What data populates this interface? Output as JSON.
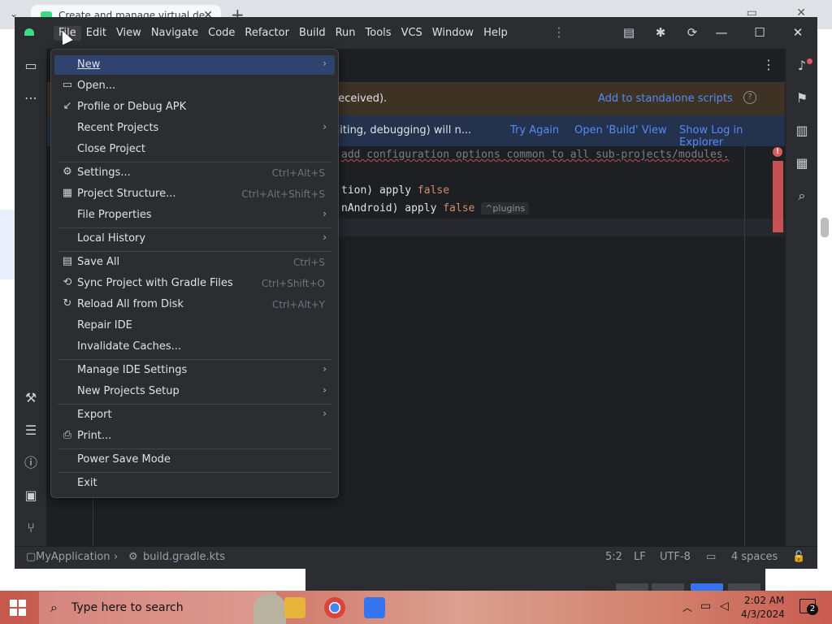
{
  "browser": {
    "tab_title": "Create and manage virtual de",
    "tab_close": "✕",
    "new_tab": "+"
  },
  "ide": {
    "menubar": [
      "File",
      "Edit",
      "View",
      "Navigate",
      "Code",
      "Refactor",
      "Build",
      "Run",
      "Tools",
      "VCS",
      "Window",
      "Help"
    ],
    "banners": {
      "gradle_sync_text": "t received).",
      "standalone_link": "Add to standalone scripts",
      "help_glyph": "?",
      "build_failed_text": "editing, debugging) will n...",
      "try_again": "Try Again",
      "open_build_view": "Open 'Build' View",
      "show_log": "Show Log in Explorer"
    },
    "editor": {
      "line1": "add configuration options common to all sub-projects/modules.",
      "line2_a": "tion) apply ",
      "line2_kw": "false",
      "line3_a": "nAndroid) apply ",
      "line3_kw": "false",
      "line3_hint": "^plugins",
      "error_glyph": "!"
    },
    "statusbar": {
      "project": "MyApplication",
      "file": "build.gradle.kts",
      "position": "5:2",
      "line_ending": "LF",
      "encoding": "UTF-8",
      "indent": "4 spaces"
    }
  },
  "file_menu": {
    "new": "New",
    "open": "Open...",
    "profile_apk": "Profile or Debug APK",
    "recent_projects": "Recent Projects",
    "close_project": "Close Project",
    "settings": "Settings...",
    "settings_shortcut": "Ctrl+Alt+S",
    "project_structure": "Project Structure...",
    "project_structure_shortcut": "Ctrl+Alt+Shift+S",
    "file_properties": "File Properties",
    "local_history": "Local History",
    "save_all": "Save All",
    "save_all_shortcut": "Ctrl+S",
    "sync_gradle": "Sync Project with Gradle Files",
    "sync_gradle_shortcut": "Ctrl+Shift+O",
    "reload_disk": "Reload All from Disk",
    "reload_disk_shortcut": "Ctrl+Alt+Y",
    "repair_ide": "Repair IDE",
    "invalidate_caches": "Invalidate Caches...",
    "manage_ide_settings": "Manage IDE Settings",
    "new_projects_setup": "New Projects Setup",
    "export": "Export",
    "print": "Print...",
    "power_save": "Power Save Mode",
    "exit": "Exit"
  },
  "taskbar": {
    "search_placeholder": "Type here to search",
    "time": "2:02 AM",
    "date": "4/3/2024",
    "notification_count": "2"
  },
  "colors": {
    "menu_selection": "#2e436e",
    "link": "#548af7",
    "warning_banner": "#3d3223",
    "info_banner": "#25324d",
    "error": "#db5c5c",
    "android_green": "#3ddc84"
  }
}
